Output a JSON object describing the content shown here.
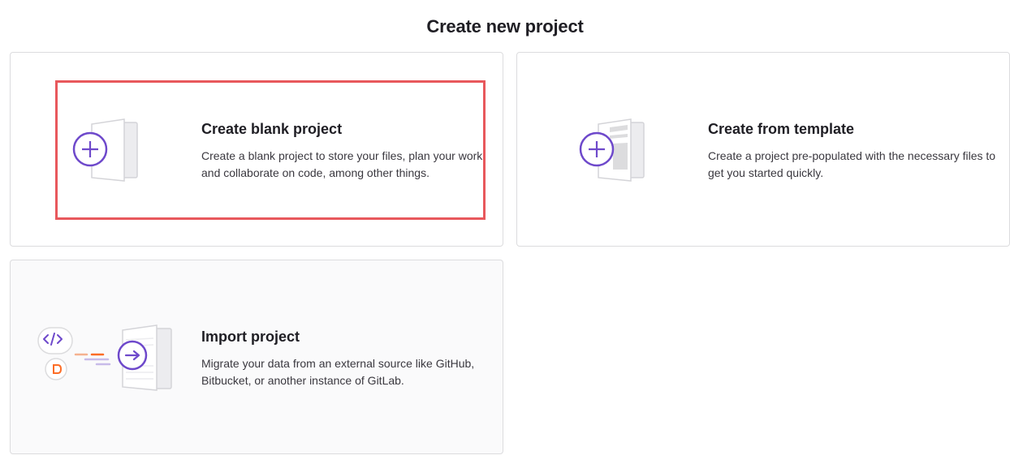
{
  "page": {
    "title": "Create new project"
  },
  "cards": {
    "blank": {
      "title": "Create blank project",
      "description": "Create a blank project to store your files, plan your work, and collaborate on code, among other things."
    },
    "template": {
      "title": "Create from template",
      "description": "Create a project pre-populated with the necessary files to get you started quickly."
    },
    "import": {
      "title": "Import project",
      "description": "Migrate your data from an external source like GitHub, Bitbucket, or another instance of GitLab."
    }
  },
  "colors": {
    "accent_purple": "#6e49cb",
    "highlight_red": "#e8585c",
    "orange": "#fc6d26"
  },
  "icons": {
    "blank": "plus-document-icon",
    "template": "template-document-icon",
    "import": "import-arrow-icon",
    "code": "code-icon",
    "gitlab": "gitlab-icon"
  }
}
